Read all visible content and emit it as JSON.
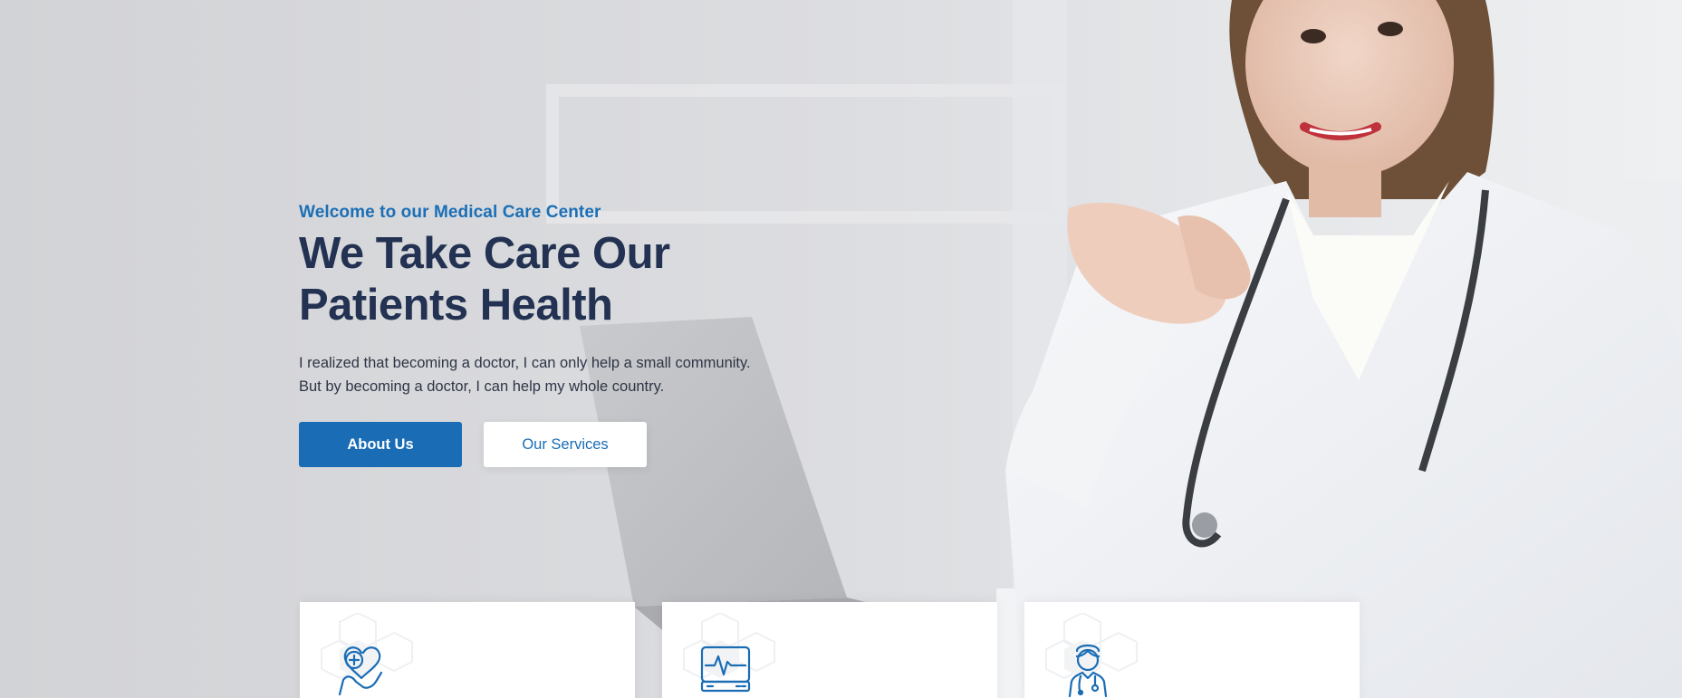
{
  "hero": {
    "eyebrow": "Welcome to our Medical Care Center",
    "headline_line1": "We Take Care Our",
    "headline_line2": "Patients Health",
    "description_line1": "I realized that becoming a doctor, I can only help a small community.",
    "description_line2": "But by becoming a doctor, I can help my whole country.",
    "primary_button": "About Us",
    "secondary_button": "Our Services"
  },
  "feature_cards": [
    {
      "icon": "heart-hand-care-icon"
    },
    {
      "icon": "heart-monitor-icon"
    },
    {
      "icon": "doctor-icon"
    }
  ],
  "colors": {
    "accent": "#1a6db5",
    "heading": "#233252",
    "body_text": "#2e3545",
    "background": "#d6d7da"
  }
}
